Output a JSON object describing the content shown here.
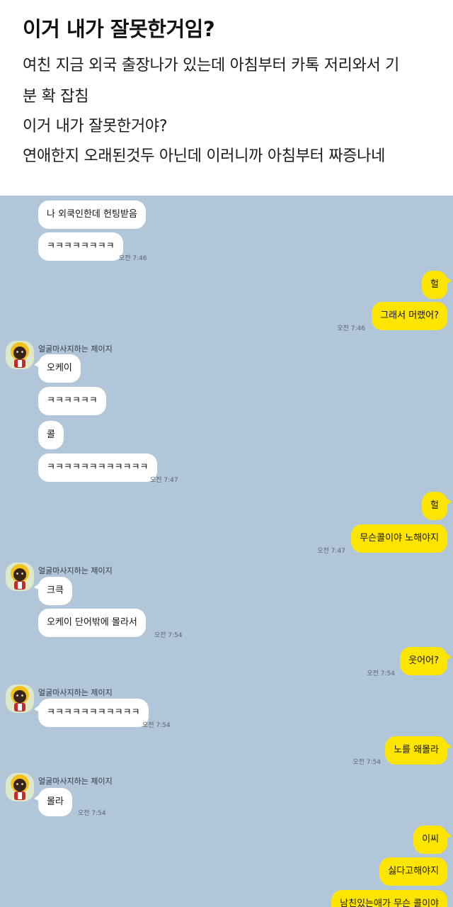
{
  "post": {
    "title": "이거 내가 잘못한거임?",
    "body_lines": [
      "여친 지금 외국 출장나가 있는데 아침부터 카톡 저리와서 기",
      "분 확 잡침",
      "이거 내가 잘못한거야?",
      "연애한지 오래된것두 아닌데 이러니까 아침부터 짜증나네"
    ]
  },
  "chat": {
    "colors": {
      "background": "#b2c6d9",
      "sent_bubble": "#fee500",
      "received_bubble": "#ffffff"
    },
    "sender_name": "얼굴마사지하는 제이지",
    "avatar_icon": "character-avatar-icon",
    "messages": [
      {
        "from": "them",
        "text": "나 외쿡인한데 헌팅받음",
        "time": ""
      },
      {
        "from": "them",
        "text": "ㅋㅋㅋㅋㅋㅋㅋㅋ",
        "time": "오전 7:46"
      },
      {
        "from": "me",
        "text": "헐",
        "time": ""
      },
      {
        "from": "me",
        "text": "그래서 머랬어?",
        "time": "오전 7:46"
      },
      {
        "from": "them",
        "text": "오케이",
        "time": ""
      },
      {
        "from": "them",
        "text": "ㅋㅋㅋㅋㅋㅋ",
        "time": ""
      },
      {
        "from": "them",
        "text": "콜",
        "time": ""
      },
      {
        "from": "them",
        "text": "ㅋㅋㅋㅋㅋㅋㅋㅋㅋㅋㅋㅋ",
        "time": "오전 7:47"
      },
      {
        "from": "me",
        "text": "헐",
        "time": ""
      },
      {
        "from": "me",
        "text": "무슨콜이야 노해야지",
        "time": "오전 7:47"
      },
      {
        "from": "them",
        "text": "크큭",
        "time": ""
      },
      {
        "from": "them",
        "text": "오케이 단어밖에 몰라서",
        "time": "오전 7:54"
      },
      {
        "from": "me",
        "text": "웃어어?",
        "time": "오전 7:54"
      },
      {
        "from": "them",
        "text": "ㅋㅋㅋㅋㅋㅋㅋㅋㅋㅋㅋ",
        "time": "오전 7:54"
      },
      {
        "from": "me",
        "text": "노를 왜몰라",
        "time": "오전 7:54"
      },
      {
        "from": "them",
        "text": "몰라",
        "time": "오전 7:54"
      },
      {
        "from": "me",
        "text": "이씨",
        "time": ""
      },
      {
        "from": "me",
        "text": "싫다고해야지",
        "time": ""
      },
      {
        "from": "me",
        "text": "남친있는애가 무슨 콜이야",
        "time": ""
      }
    ]
  }
}
